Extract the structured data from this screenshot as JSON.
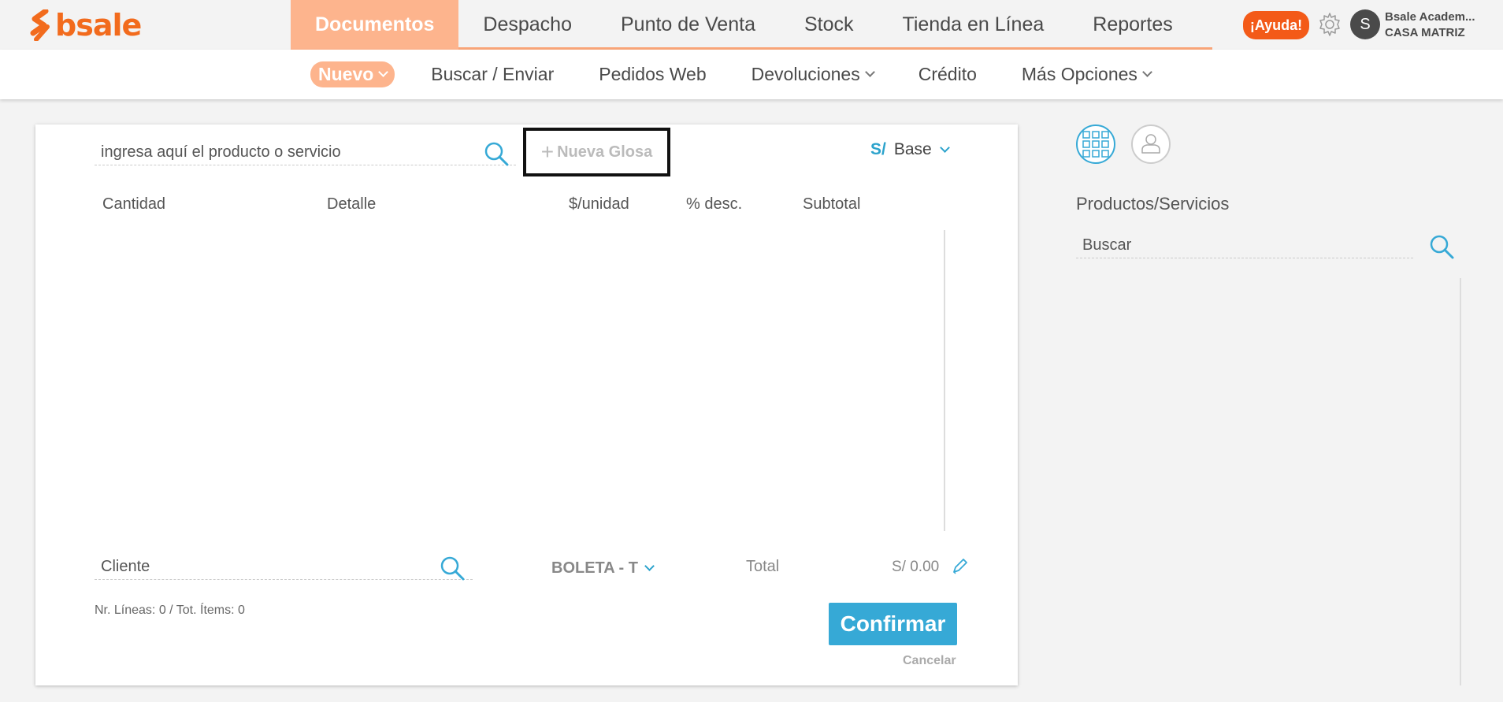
{
  "brand": {
    "name": "bsale",
    "color": "#f26b1d"
  },
  "main_nav": {
    "items": [
      {
        "label": "Documentos",
        "active": true
      },
      {
        "label": "Despacho",
        "active": false
      },
      {
        "label": "Punto de Venta",
        "active": false
      },
      {
        "label": "Stock",
        "active": false
      },
      {
        "label": "Tienda en Línea",
        "active": false
      },
      {
        "label": "Reportes",
        "active": false
      }
    ]
  },
  "header": {
    "help_label": "¡Ayuda!",
    "avatar_initial": "S",
    "user_name": "Bsale Academ...",
    "branch": "CASA MATRIZ",
    "settings_icon": "gear-icon"
  },
  "sub_nav": {
    "items": [
      {
        "label": "Nuevo",
        "active": true,
        "dropdown": true
      },
      {
        "label": "Buscar / Enviar",
        "active": false,
        "dropdown": false
      },
      {
        "label": "Pedidos Web",
        "active": false,
        "dropdown": false
      },
      {
        "label": "Devoluciones",
        "active": false,
        "dropdown": true
      },
      {
        "label": "Crédito",
        "active": false,
        "dropdown": false
      },
      {
        "label": "Más Opciones",
        "active": false,
        "dropdown": true
      }
    ]
  },
  "document": {
    "product_placeholder": "ingresa aquí el producto o servicio",
    "new_glosa_label": "Nueva Glosa",
    "currency_symbol": "S/",
    "price_list": "Base",
    "columns": [
      "Cantidad",
      "Detalle",
      "$/unidad",
      "% desc.",
      "Subtotal"
    ],
    "client_placeholder": "Cliente",
    "document_type": "BOLETA - T",
    "total_label": "Total",
    "total_value": "S/ 0.00",
    "counts": "Nr. Líneas: 0 / Tot. Ítems: 0",
    "confirm_label": "Confirmar",
    "cancel_label": "Cancelar"
  },
  "right_panel": {
    "title": "Productos/Servicios",
    "search_placeholder": "Buscar",
    "views": [
      "grid-view-icon",
      "user-view-icon"
    ]
  },
  "colors": {
    "accent_orange": "#fdb48d",
    "help_orange": "#f35a18",
    "accent_blue": "#36a9d6"
  }
}
